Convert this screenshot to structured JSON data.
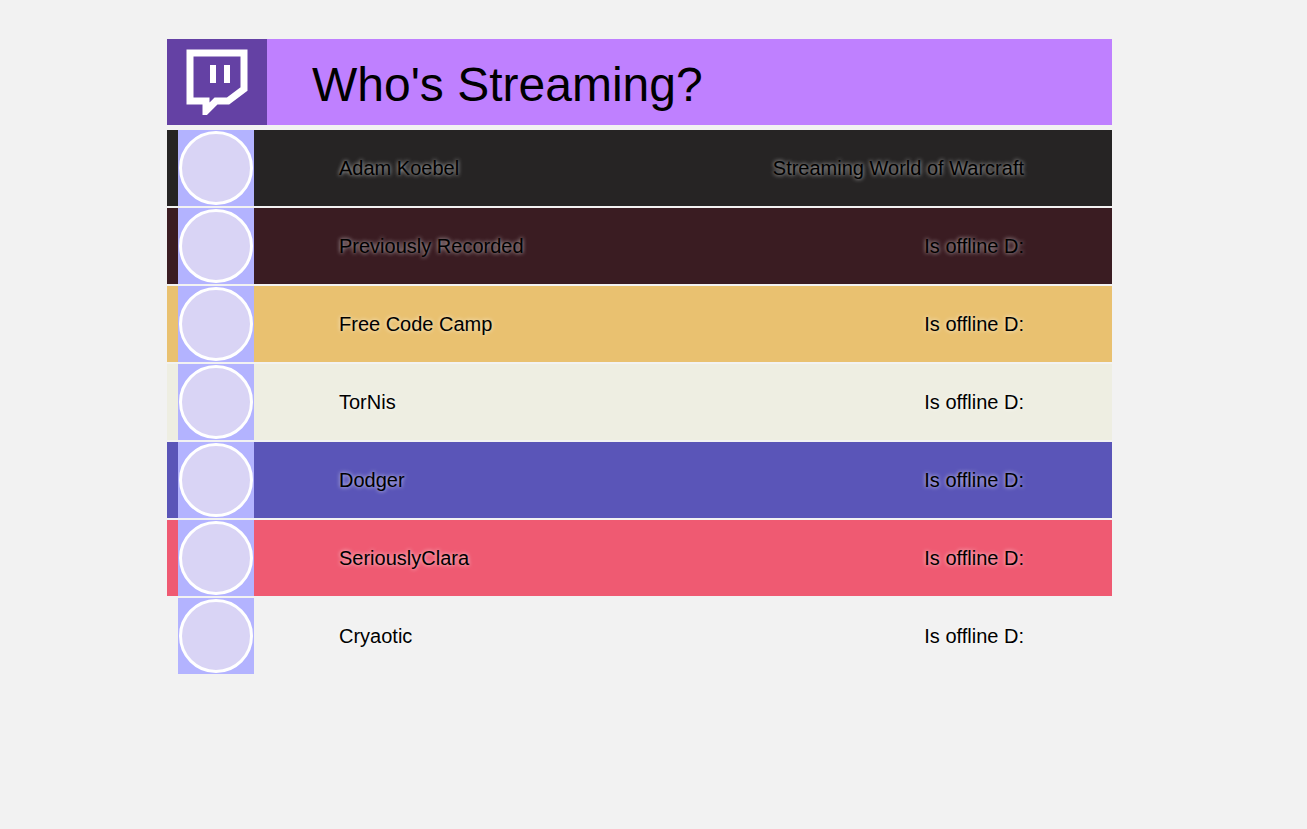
{
  "header": {
    "title": "Who's Streaming?"
  },
  "streamers": [
    {
      "name": "Adam Koebel",
      "status": "Streaming World of Warcraft",
      "online": true,
      "color": "#262424"
    },
    {
      "name": "Previously Recorded",
      "status": "Is offline D:",
      "online": false,
      "color": "#3a1c22"
    },
    {
      "name": "Free Code Camp",
      "status": "Is offline D:",
      "online": false,
      "color": "#e9c170"
    },
    {
      "name": "TorNis",
      "status": "Is offline D:",
      "online": false,
      "color": "#eeeee2"
    },
    {
      "name": "Dodger",
      "status": "Is offline D:",
      "online": false,
      "color": "#5a55b8"
    },
    {
      "name": "SeriouslyClara",
      "status": "Is offline D:",
      "online": false,
      "color": "#ef5a72"
    },
    {
      "name": "Cryaotic",
      "status": "Is offline D:",
      "online": false,
      "color": "#f2f2f2"
    }
  ]
}
